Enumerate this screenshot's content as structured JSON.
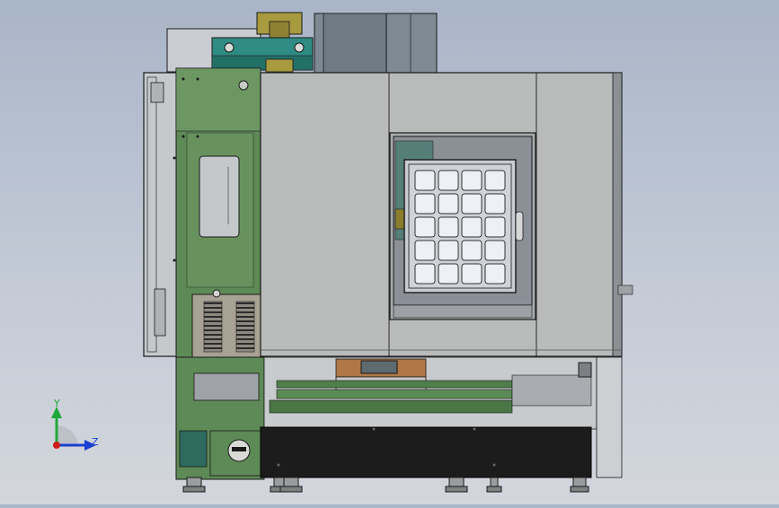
{
  "viewport": {
    "background_top": "#a9b5c8",
    "background_bottom": "#d3d6dc",
    "model": "cnc-machining-center-side-view"
  },
  "triad": {
    "y_label": "Y",
    "z_label": "Z",
    "y_color": "#1fa83a",
    "z_color": "#1b3fd0",
    "x_color": "#d01b1b"
  },
  "colors": {
    "panel_gray": "#b9bbba",
    "panel_green": "#5d8a56",
    "teal": "#2e8c84",
    "olive": "#a79a3f",
    "black_base": "#1c1c1c",
    "edge": "#1a1a1a",
    "glass": "#8b8f96"
  }
}
